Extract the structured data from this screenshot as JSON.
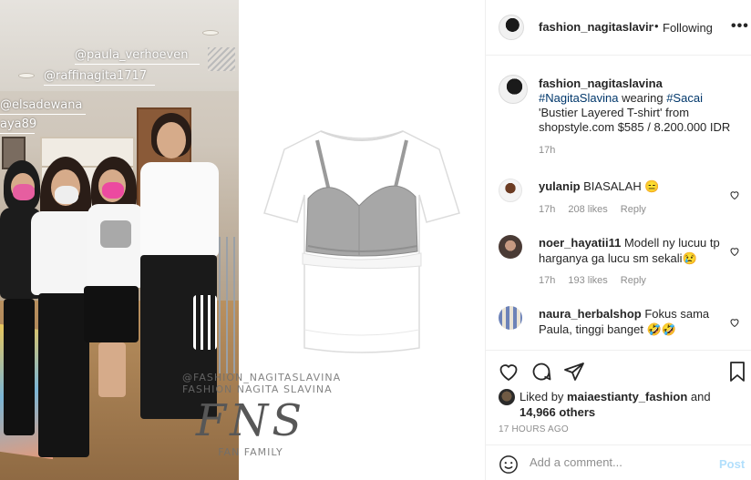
{
  "media": {
    "photo_tags": [
      "@paula_verhoeven",
      "@raffinagita1717",
      "@elsadewana",
      "aya89"
    ],
    "watermark": {
      "top": "@FASHION_NAGITASLAVINA",
      "mid": "FASHION NAGITA SLAVINA",
      "logo": "FNS",
      "bottom": "FAN FAMILY"
    }
  },
  "header": {
    "username": "fashion_nagitaslavina",
    "separator": "•",
    "follow_status": "Following",
    "more_label": "•••"
  },
  "caption": {
    "username": "fashion_nagitaslavina",
    "hashtag1": "#NagitaSlavina",
    "word": " wearing ",
    "hashtag2": "#Sacai",
    "body": "'Bustier Layered T-shirt' from shopstyle.com $585 / 8.200.000 IDR",
    "time": "17h"
  },
  "comments": [
    {
      "username": "yulanip",
      "text": "BIASALAH 😑",
      "time": "17h",
      "likes": "208 likes",
      "reply": "Reply"
    },
    {
      "username": "noer_hayatii11",
      "text": "Modell ny lucuu tp harganya ga lucu sm sekali😢",
      "time": "17h",
      "likes": "193 likes",
      "reply": "Reply"
    },
    {
      "username": "naura_herbalshop",
      "text": "Fokus sama Paula, tinggi banget 🤣🤣",
      "time": "",
      "likes": "",
      "reply": ""
    }
  ],
  "likes": {
    "prefix": "Liked by ",
    "user": "maiaestianty_fashion",
    "and": " and",
    "count": "14,966 others"
  },
  "post_time": "17 HOURS AGO",
  "add_comment": {
    "placeholder": "Add a comment...",
    "post_label": "Post"
  },
  "colors": {
    "link": "#00376b",
    "muted": "#8e8e8e",
    "post_disabled": "#b2dffc",
    "border": "#efefef"
  },
  "icons": [
    "heart-icon",
    "comment-icon",
    "share-icon",
    "bookmark-icon",
    "emoji-icon",
    "more-icon"
  ]
}
